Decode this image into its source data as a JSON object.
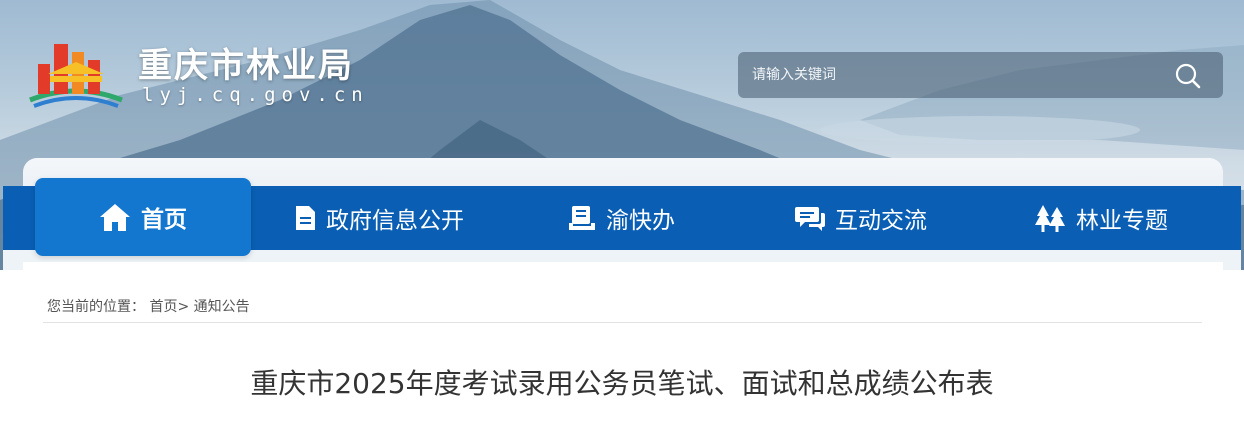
{
  "header": {
    "site_title": "重庆市林业局",
    "site_domain": "lyj.cq.gov.cn"
  },
  "search": {
    "placeholder": "请输入关键词"
  },
  "nav": {
    "items": [
      {
        "label": "首页",
        "icon": "home-icon",
        "active": true
      },
      {
        "label": "政府信息公开",
        "icon": "document-icon"
      },
      {
        "label": "渝快办",
        "icon": "service-book-icon"
      },
      {
        "label": "互动交流",
        "icon": "chat-icon"
      },
      {
        "label": "林业专题",
        "icon": "trees-icon"
      }
    ]
  },
  "breadcrumb": {
    "prefix": "您当前的位置：",
    "home": "首页",
    "separator": ">",
    "current": "通知公告"
  },
  "article": {
    "title": "重庆市2025年度考试录用公务员笔试、面试和总成绩公布表"
  },
  "colors": {
    "nav_bg": "#0a5fb4",
    "nav_active": "#1477cf"
  }
}
